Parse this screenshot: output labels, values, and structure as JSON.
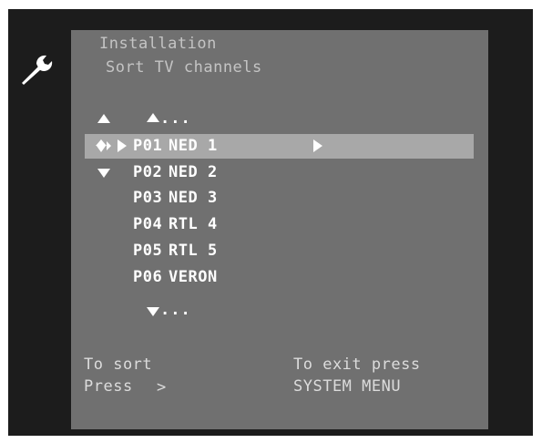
{
  "menu": {
    "title": "Installation",
    "subtitle": "Sort TV channels"
  },
  "list": {
    "more_above": "...",
    "more_below": "...",
    "channels": [
      {
        "number": "P01",
        "name": "NED 1",
        "selected": true
      },
      {
        "number": "P02",
        "name": "NED 2"
      },
      {
        "number": "P03",
        "name": "NED 3"
      },
      {
        "number": "P04",
        "name": "RTL 4"
      },
      {
        "number": "P05",
        "name": "RTL 5"
      },
      {
        "number": "P06",
        "name": "VERON"
      }
    ]
  },
  "footer": {
    "sort_label": "To sort",
    "sort_press": "Press",
    "sort_key": ">",
    "exit_label": "To exit press",
    "exit_key": "SYSTEM MENU"
  },
  "icons": {
    "settings": "wrench-icon",
    "cursor": "navigation-cursor-icon"
  },
  "colors": {
    "screen_bg": "#1c1c1c",
    "panel_bg": "#707070",
    "highlight": "#a8a8a8",
    "text": "#dcdcdc"
  }
}
